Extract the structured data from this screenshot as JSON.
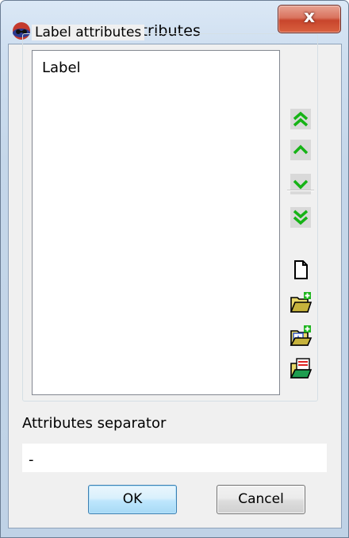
{
  "window": {
    "title": "Layer label attributes",
    "close_label": "x"
  },
  "group": {
    "title": "Label attributes",
    "items": [
      "Label"
    ]
  },
  "toolbar": {
    "buttons": [
      {
        "name": "move-top-button",
        "icon": "double-chevron-up-icon"
      },
      {
        "name": "move-up-button",
        "icon": "chevron-up-icon"
      },
      {
        "name": "move-down-button",
        "icon": "chevron-down-icon"
      },
      {
        "name": "move-bottom-button",
        "icon": "double-chevron-down-icon"
      },
      {
        "name": "new-button",
        "icon": "new-document-icon"
      },
      {
        "name": "add-from-folder-button",
        "icon": "folder-add-icon"
      },
      {
        "name": "add-special-button",
        "icon": "folder-special-icon"
      },
      {
        "name": "edit-list-button",
        "icon": "folder-list-icon"
      }
    ]
  },
  "separator": {
    "label": "Attributes separator",
    "value": "-"
  },
  "buttons": {
    "ok": "OK",
    "cancel": "Cancel"
  }
}
